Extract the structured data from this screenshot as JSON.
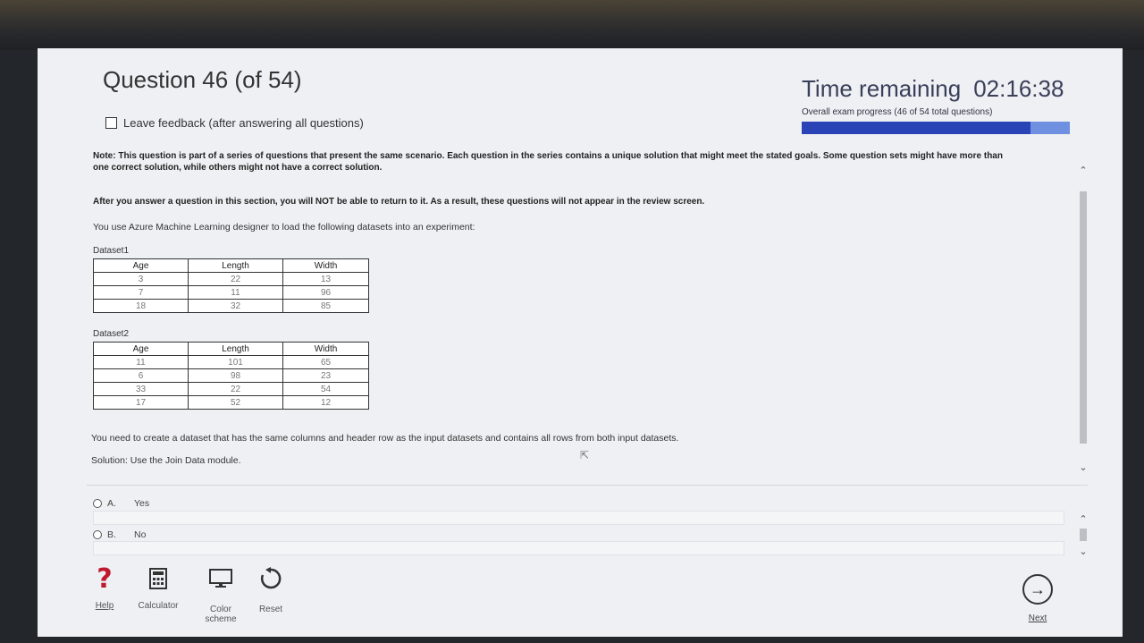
{
  "header": {
    "question_title": "Question 46 (of 54)",
    "time_label": "Time remaining",
    "time_value": "02:16:38",
    "progress_label": "Overall exam progress (46 of 54 total questions)",
    "progress_fraction": 0.852
  },
  "feedback": {
    "label": "Leave feedback (after answering all questions)"
  },
  "question": {
    "note": "Note: This question is part of a series of questions that present the same scenario. Each question in the series contains a unique solution that might meet the stated goals. Some question sets might have more than one correct solution, while others might not have a correct solution.",
    "note2": "After you answer a question in this section, you will NOT be able to return to it. As a result, these questions will not appear in the review screen.",
    "intro": "You use Azure Machine Learning designer to load the following datasets into an experiment:",
    "dataset1": {
      "label": "Dataset1",
      "headers": [
        "Age",
        "Length",
        "Width"
      ],
      "rows": [
        [
          "3",
          "22",
          "13"
        ],
        [
          "7",
          "11",
          "96"
        ],
        [
          "18",
          "32",
          "85"
        ]
      ]
    },
    "dataset2": {
      "label": "Dataset2",
      "headers": [
        "Age",
        "Length",
        "Width"
      ],
      "rows": [
        [
          "11",
          "101",
          "65"
        ],
        [
          "6",
          "98",
          "23"
        ],
        [
          "33",
          "22",
          "54"
        ],
        [
          "17",
          "52",
          "12"
        ]
      ]
    },
    "need": "You need to create a dataset that has the same columns and header row as the input datasets and contains all rows from both input datasets.",
    "solution": "Solution: Use the Join Data module."
  },
  "options": [
    {
      "letter": "A.",
      "text": "Yes"
    },
    {
      "letter": "B.",
      "text": "No"
    }
  ],
  "toolbar": {
    "help": "Help",
    "calculator": "Calculator",
    "color_line1": "Color",
    "color_line2": "scheme",
    "reset": "Reset",
    "next": "Next"
  }
}
